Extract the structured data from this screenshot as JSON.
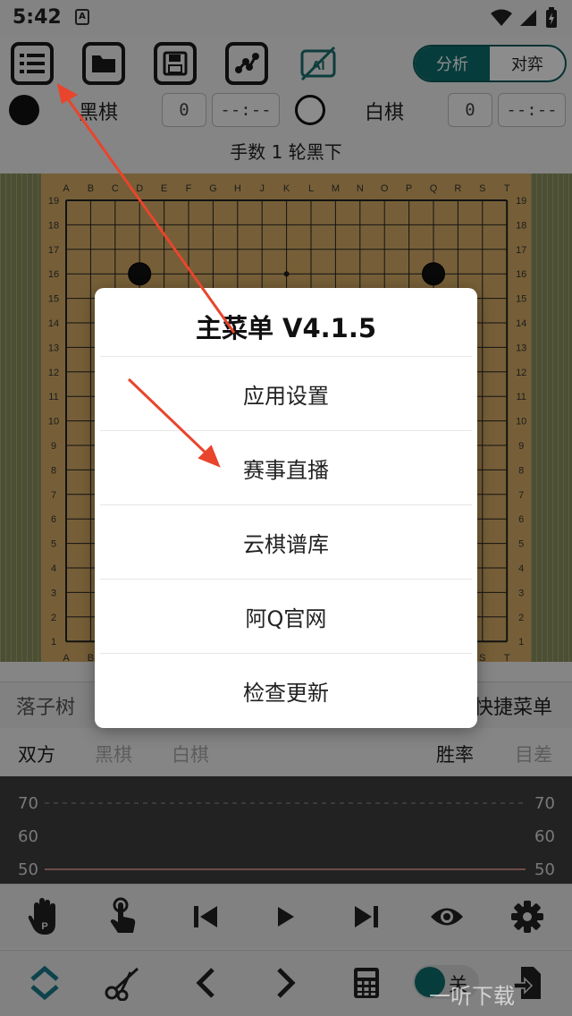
{
  "status_bar": {
    "time": "5:42",
    "icons": [
      "notification-a-icon",
      "wifi-icon",
      "signal-icon",
      "battery-charging-icon"
    ]
  },
  "toolbar": {
    "buttons": [
      "menu-list-icon",
      "folder-icon",
      "save-icon",
      "share-icon",
      "ai-off-icon"
    ],
    "mode_tabs": [
      {
        "label": "分析",
        "active": true
      },
      {
        "label": "对弈",
        "active": false
      }
    ]
  },
  "players": {
    "black": {
      "label": "黑棋",
      "captures": "0",
      "time": "--:--"
    },
    "white": {
      "label": "白棋",
      "captures": "0",
      "time": "--:--"
    }
  },
  "move_status": "手数 1  轮黑下",
  "board": {
    "columns": [
      "A",
      "B",
      "C",
      "D",
      "E",
      "F",
      "G",
      "H",
      "J",
      "K",
      "L",
      "M",
      "N",
      "O",
      "P",
      "Q",
      "R",
      "S",
      "T"
    ],
    "rows": [
      "19",
      "18",
      "17",
      "16",
      "15",
      "14",
      "13",
      "12",
      "11",
      "10",
      "9",
      "8",
      "7",
      "6",
      "5",
      "4",
      "3",
      "2",
      "1"
    ],
    "stones": [
      {
        "col": "D",
        "row": "16",
        "color": "black"
      },
      {
        "col": "Q",
        "row": "16",
        "color": "black"
      }
    ]
  },
  "tree_bar": {
    "label": "落子树",
    "quick_menu": "快捷菜单"
  },
  "graph_tabs": {
    "items": [
      {
        "label": "双方",
        "active": true
      },
      {
        "label": "黑棋",
        "active": false
      },
      {
        "label": "白棋",
        "active": false
      }
    ],
    "right": [
      {
        "label": "胜率",
        "active": true
      },
      {
        "label": "目差",
        "active": false
      }
    ]
  },
  "graph": {
    "y_labels": [
      "70",
      "60",
      "50"
    ]
  },
  "controls_row1": [
    "pass-hand-icon",
    "tap-hand-icon",
    "skip-to-start-icon",
    "play-icon",
    "skip-to-end-icon",
    "eye-icon",
    "gear-icon"
  ],
  "controls_row2": {
    "icons": [
      "collapse-expand-icon",
      "scissors-icon",
      "chevron-left-icon",
      "chevron-right-icon",
      "calculator-icon",
      "document-export-icon"
    ],
    "toggle_label": "关"
  },
  "dialog": {
    "title": "主菜单 V4.1.5",
    "items": [
      "应用设置",
      "赛事直播",
      "云棋谱库",
      "阿Q官网",
      "检查更新"
    ]
  },
  "watermark": "一听下载",
  "colors": {
    "accent": "#0e6e6e",
    "board": "#d7ae66",
    "annotation_arrow": "#e8452c"
  }
}
